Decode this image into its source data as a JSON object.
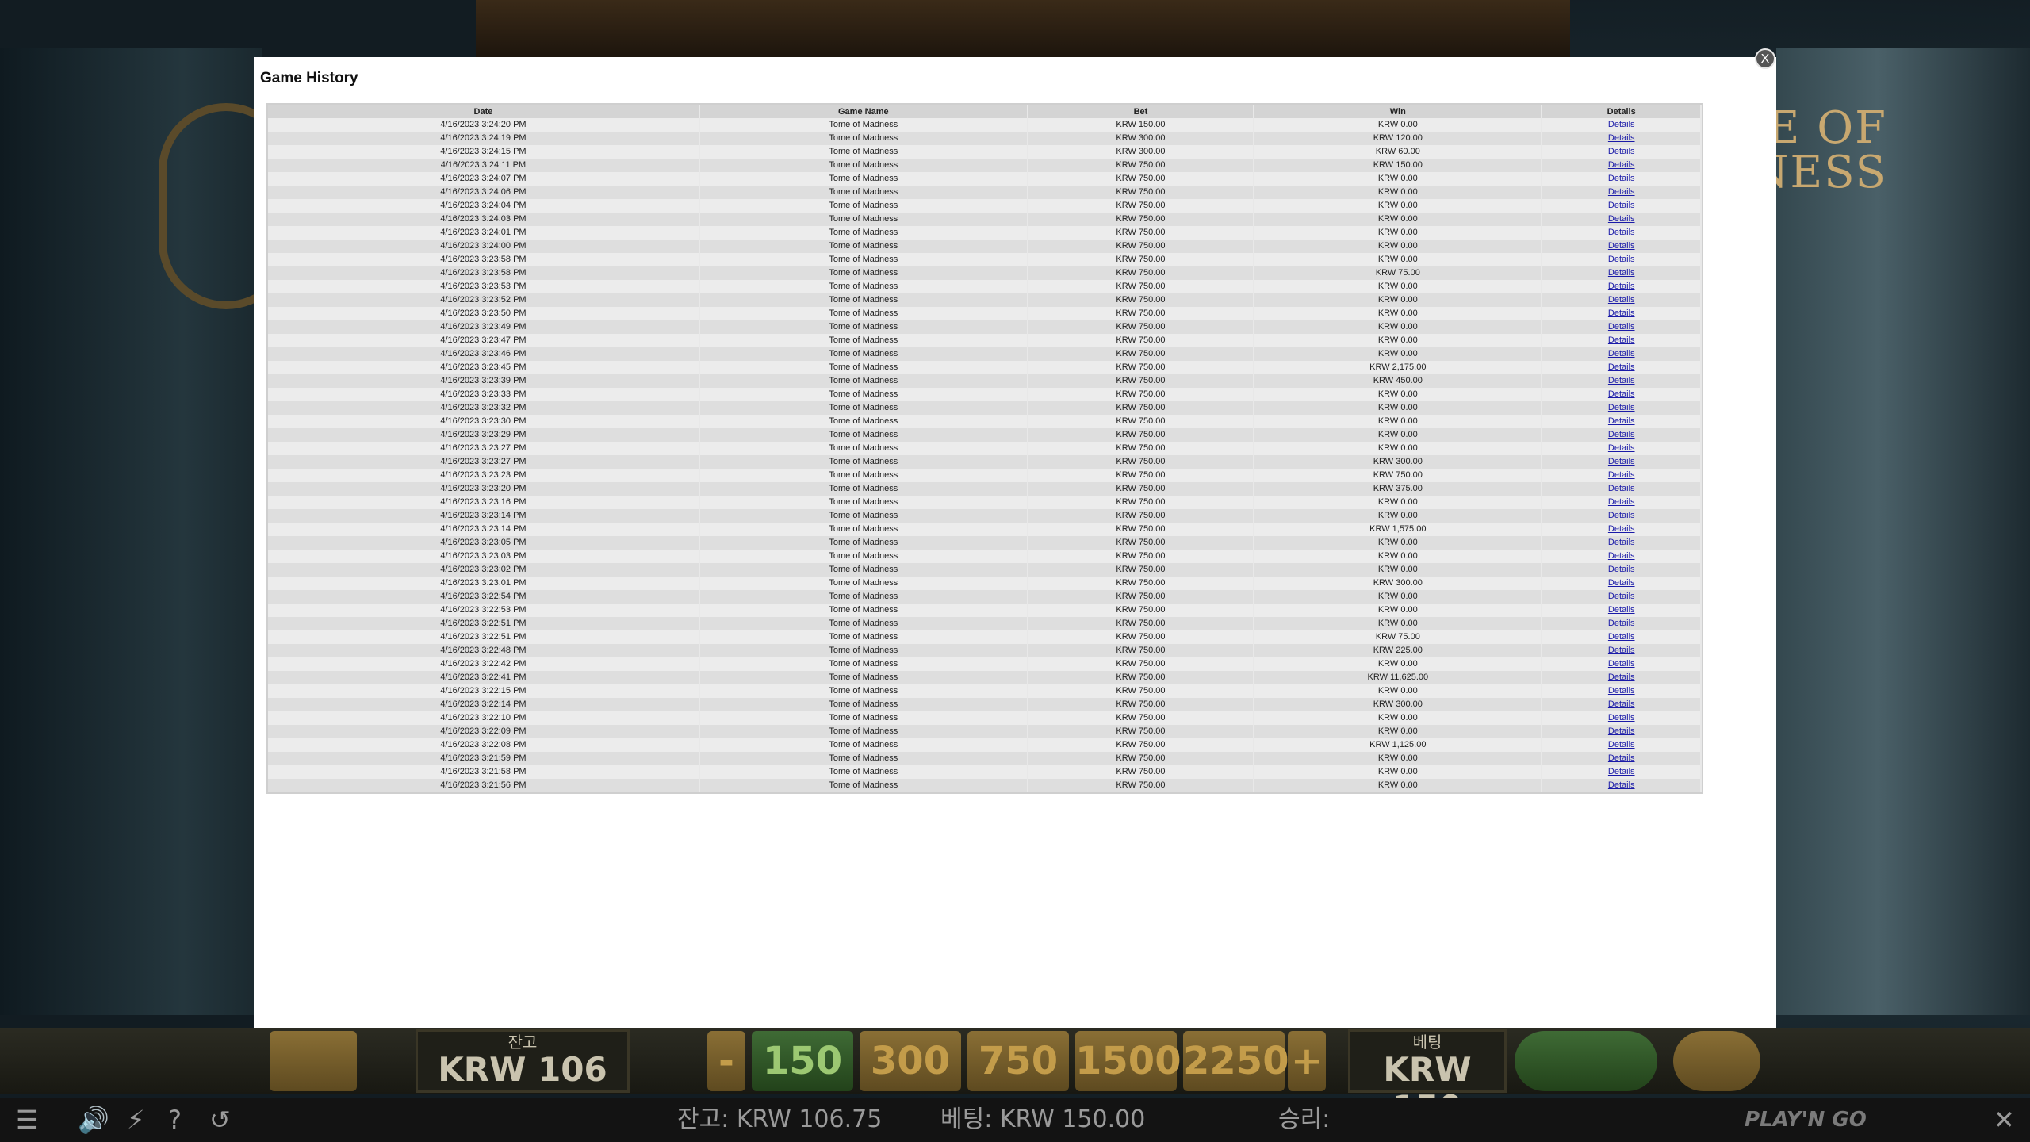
{
  "modal": {
    "title": "Game History",
    "close_label": "X",
    "columns": [
      "Date",
      "Game Name",
      "Bet",
      "Win",
      "Details"
    ],
    "rows": [
      [
        "4/16/2023 3:24:20 PM",
        "Tome of Madness",
        "KRW 150.00",
        "KRW 0.00",
        "Details"
      ],
      [
        "4/16/2023 3:24:19 PM",
        "Tome of Madness",
        "KRW 300.00",
        "KRW 120.00",
        "Details"
      ],
      [
        "4/16/2023 3:24:15 PM",
        "Tome of Madness",
        "KRW 300.00",
        "KRW 60.00",
        "Details"
      ],
      [
        "4/16/2023 3:24:11 PM",
        "Tome of Madness",
        "KRW 750.00",
        "KRW 150.00",
        "Details"
      ],
      [
        "4/16/2023 3:24:07 PM",
        "Tome of Madness",
        "KRW 750.00",
        "KRW 0.00",
        "Details"
      ],
      [
        "4/16/2023 3:24:06 PM",
        "Tome of Madness",
        "KRW 750.00",
        "KRW 0.00",
        "Details"
      ],
      [
        "4/16/2023 3:24:04 PM",
        "Tome of Madness",
        "KRW 750.00",
        "KRW 0.00",
        "Details"
      ],
      [
        "4/16/2023 3:24:03 PM",
        "Tome of Madness",
        "KRW 750.00",
        "KRW 0.00",
        "Details"
      ],
      [
        "4/16/2023 3:24:01 PM",
        "Tome of Madness",
        "KRW 750.00",
        "KRW 0.00",
        "Details"
      ],
      [
        "4/16/2023 3:24:00 PM",
        "Tome of Madness",
        "KRW 750.00",
        "KRW 0.00",
        "Details"
      ],
      [
        "4/16/2023 3:23:58 PM",
        "Tome of Madness",
        "KRW 750.00",
        "KRW 0.00",
        "Details"
      ],
      [
        "4/16/2023 3:23:58 PM",
        "Tome of Madness",
        "KRW 750.00",
        "KRW 75.00",
        "Details"
      ],
      [
        "4/16/2023 3:23:53 PM",
        "Tome of Madness",
        "KRW 750.00",
        "KRW 0.00",
        "Details"
      ],
      [
        "4/16/2023 3:23:52 PM",
        "Tome of Madness",
        "KRW 750.00",
        "KRW 0.00",
        "Details"
      ],
      [
        "4/16/2023 3:23:50 PM",
        "Tome of Madness",
        "KRW 750.00",
        "KRW 0.00",
        "Details"
      ],
      [
        "4/16/2023 3:23:49 PM",
        "Tome of Madness",
        "KRW 750.00",
        "KRW 0.00",
        "Details"
      ],
      [
        "4/16/2023 3:23:47 PM",
        "Tome of Madness",
        "KRW 750.00",
        "KRW 0.00",
        "Details"
      ],
      [
        "4/16/2023 3:23:46 PM",
        "Tome of Madness",
        "KRW 750.00",
        "KRW 0.00",
        "Details"
      ],
      [
        "4/16/2023 3:23:45 PM",
        "Tome of Madness",
        "KRW 750.00",
        "KRW 2,175.00",
        "Details"
      ],
      [
        "4/16/2023 3:23:39 PM",
        "Tome of Madness",
        "KRW 750.00",
        "KRW 450.00",
        "Details"
      ],
      [
        "4/16/2023 3:23:33 PM",
        "Tome of Madness",
        "KRW 750.00",
        "KRW 0.00",
        "Details"
      ],
      [
        "4/16/2023 3:23:32 PM",
        "Tome of Madness",
        "KRW 750.00",
        "KRW 0.00",
        "Details"
      ],
      [
        "4/16/2023 3:23:30 PM",
        "Tome of Madness",
        "KRW 750.00",
        "KRW 0.00",
        "Details"
      ],
      [
        "4/16/2023 3:23:29 PM",
        "Tome of Madness",
        "KRW 750.00",
        "KRW 0.00",
        "Details"
      ],
      [
        "4/16/2023 3:23:27 PM",
        "Tome of Madness",
        "KRW 750.00",
        "KRW 0.00",
        "Details"
      ],
      [
        "4/16/2023 3:23:27 PM",
        "Tome of Madness",
        "KRW 750.00",
        "KRW 300.00",
        "Details"
      ],
      [
        "4/16/2023 3:23:23 PM",
        "Tome of Madness",
        "KRW 750.00",
        "KRW 750.00",
        "Details"
      ],
      [
        "4/16/2023 3:23:20 PM",
        "Tome of Madness",
        "KRW 750.00",
        "KRW 375.00",
        "Details"
      ],
      [
        "4/16/2023 3:23:16 PM",
        "Tome of Madness",
        "KRW 750.00",
        "KRW 0.00",
        "Details"
      ],
      [
        "4/16/2023 3:23:14 PM",
        "Tome of Madness",
        "KRW 750.00",
        "KRW 0.00",
        "Details"
      ],
      [
        "4/16/2023 3:23:14 PM",
        "Tome of Madness",
        "KRW 750.00",
        "KRW 1,575.00",
        "Details"
      ],
      [
        "4/16/2023 3:23:05 PM",
        "Tome of Madness",
        "KRW 750.00",
        "KRW 0.00",
        "Details"
      ],
      [
        "4/16/2023 3:23:03 PM",
        "Tome of Madness",
        "KRW 750.00",
        "KRW 0.00",
        "Details"
      ],
      [
        "4/16/2023 3:23:02 PM",
        "Tome of Madness",
        "KRW 750.00",
        "KRW 0.00",
        "Details"
      ],
      [
        "4/16/2023 3:23:01 PM",
        "Tome of Madness",
        "KRW 750.00",
        "KRW 300.00",
        "Details"
      ],
      [
        "4/16/2023 3:22:54 PM",
        "Tome of Madness",
        "KRW 750.00",
        "KRW 0.00",
        "Details"
      ],
      [
        "4/16/2023 3:22:53 PM",
        "Tome of Madness",
        "KRW 750.00",
        "KRW 0.00",
        "Details"
      ],
      [
        "4/16/2023 3:22:51 PM",
        "Tome of Madness",
        "KRW 750.00",
        "KRW 0.00",
        "Details"
      ],
      [
        "4/16/2023 3:22:51 PM",
        "Tome of Madness",
        "KRW 750.00",
        "KRW 75.00",
        "Details"
      ],
      [
        "4/16/2023 3:22:48 PM",
        "Tome of Madness",
        "KRW 750.00",
        "KRW 225.00",
        "Details"
      ],
      [
        "4/16/2023 3:22:42 PM",
        "Tome of Madness",
        "KRW 750.00",
        "KRW 0.00",
        "Details"
      ],
      [
        "4/16/2023 3:22:41 PM",
        "Tome of Madness",
        "KRW 750.00",
        "KRW 11,625.00",
        "Details"
      ],
      [
        "4/16/2023 3:22:15 PM",
        "Tome of Madness",
        "KRW 750.00",
        "KRW 0.00",
        "Details"
      ],
      [
        "4/16/2023 3:22:14 PM",
        "Tome of Madness",
        "KRW 750.00",
        "KRW 300.00",
        "Details"
      ],
      [
        "4/16/2023 3:22:10 PM",
        "Tome of Madness",
        "KRW 750.00",
        "KRW 0.00",
        "Details"
      ],
      [
        "4/16/2023 3:22:09 PM",
        "Tome of Madness",
        "KRW 750.00",
        "KRW 0.00",
        "Details"
      ],
      [
        "4/16/2023 3:22:08 PM",
        "Tome of Madness",
        "KRW 750.00",
        "KRW 1,125.00",
        "Details"
      ],
      [
        "4/16/2023 3:21:59 PM",
        "Tome of Madness",
        "KRW 750.00",
        "KRW 0.00",
        "Details"
      ],
      [
        "4/16/2023 3:21:58 PM",
        "Tome of Madness",
        "KRW 750.00",
        "KRW 0.00",
        "Details"
      ],
      [
        "4/16/2023 3:21:56 PM",
        "Tome of Madness",
        "KRW 750.00",
        "KRW 0.00",
        "Details"
      ]
    ]
  },
  "game": {
    "logo_text": "E OF\nNESS",
    "balance_label": "잔고",
    "balance_value": "KRW 106",
    "bet_label": "베팅",
    "bet_value": "KRW 150",
    "minus_label": "-",
    "plus_label": "+",
    "bet_options": [
      "150",
      "300",
      "750",
      "1500",
      "2250"
    ]
  },
  "statusbar": {
    "balance_text": "잔고: KRW 106.75",
    "bet_text": "베팅: KRW 150.00",
    "win_text": "승리:",
    "help_label": "?",
    "brand": "PLAY'N GO",
    "close_label": "✕"
  },
  "colors": {
    "link": "#1a1aa8",
    "modal_bg": "#ffffff",
    "header_bg": "#d4d4d4"
  }
}
